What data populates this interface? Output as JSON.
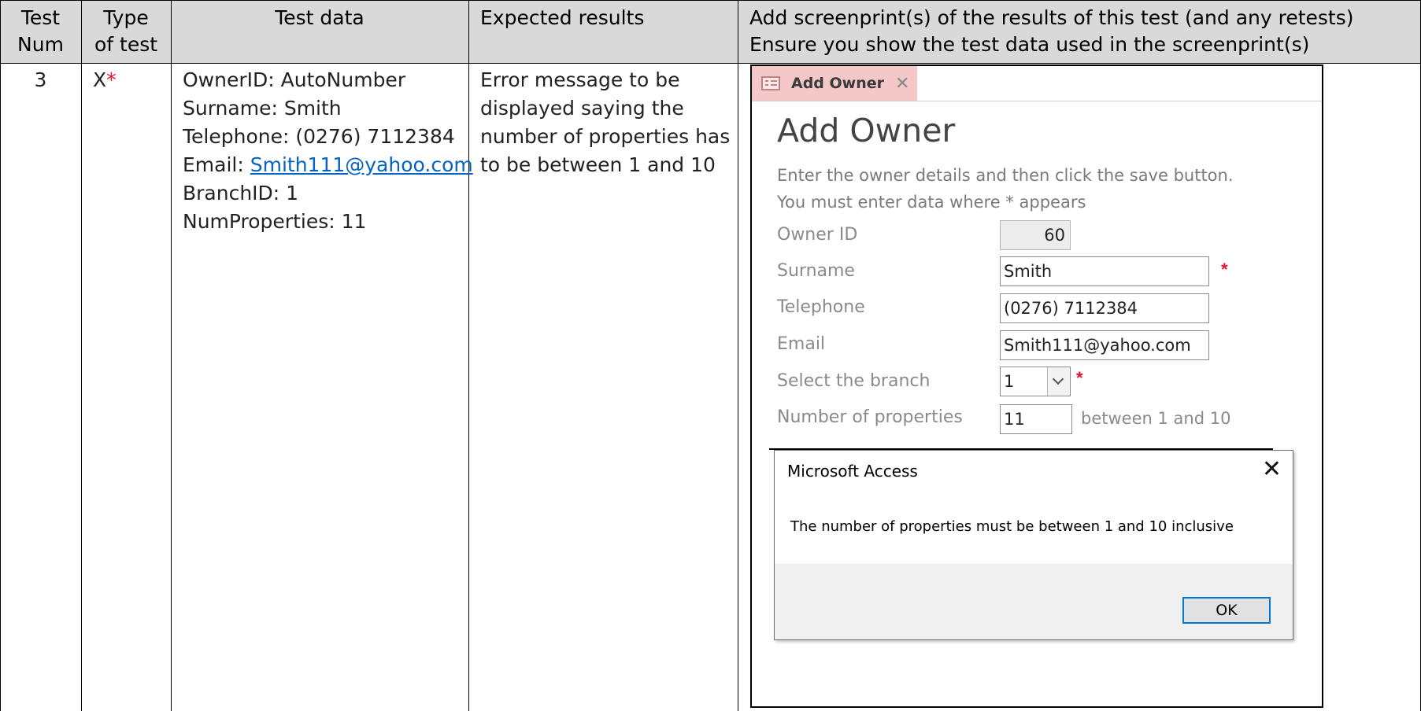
{
  "headers": {
    "test_num": [
      "Test",
      "Num"
    ],
    "type": [
      "Type",
      "of test"
    ],
    "test_data": "Test data",
    "expected": "Expected results",
    "screenprint": [
      "Add screenprint(s) of the results of this test (and any retests)",
      "Ensure you show the test data used in the screenprint(s)"
    ]
  },
  "row": {
    "num": "3",
    "type": "X",
    "type_mark": "*",
    "test_data": {
      "owner_id": "OwnerID: AutoNumber",
      "surname": "Surname: Smith",
      "telephone": "Telephone: (0276) 7112384",
      "email_prefix": "Email: ",
      "email": "Smith111@yahoo.com",
      "branch": "BranchID: 1",
      "num_properties": "NumProperties: 11"
    },
    "expected": [
      "Error message to be",
      "displayed saying the",
      "number of properties has",
      "to be between 1 and 10"
    ]
  },
  "access": {
    "tab_label": "Add Owner",
    "tab_close": "✕",
    "title": "Add Owner",
    "instructions": [
      "Enter the owner details and then click the save button.",
      "You must enter data where * appears"
    ],
    "fields": {
      "owner_id_label": "Owner ID",
      "owner_id_value": "60",
      "surname_label": "Surname",
      "surname_value": "Smith",
      "telephone_label": "Telephone",
      "telephone_value": "(0276) 7112384",
      "email_label": "Email",
      "email_value": "Smith111@yahoo.com",
      "branch_label": "Select the branch",
      "branch_value": "1",
      "properties_label": "Number of properties",
      "properties_value": "11",
      "properties_hint": "between 1 and 10"
    },
    "required_mark": "*",
    "dialog": {
      "title": "Microsoft Access",
      "close": "✕",
      "message": "The number of properties must be between 1 and 10 inclusive",
      "ok_label": "OK"
    }
  },
  "colors": {
    "header_bg": "#d9d9d9",
    "required": "#e81123",
    "link": "#0563c1",
    "tab_bg": "#f4c7c9",
    "ok_focus": "#0078d7"
  },
  "icons": {
    "tab_icon": "form-icon",
    "combo": "chevron-down-icon",
    "dialog_close": "close-icon"
  }
}
